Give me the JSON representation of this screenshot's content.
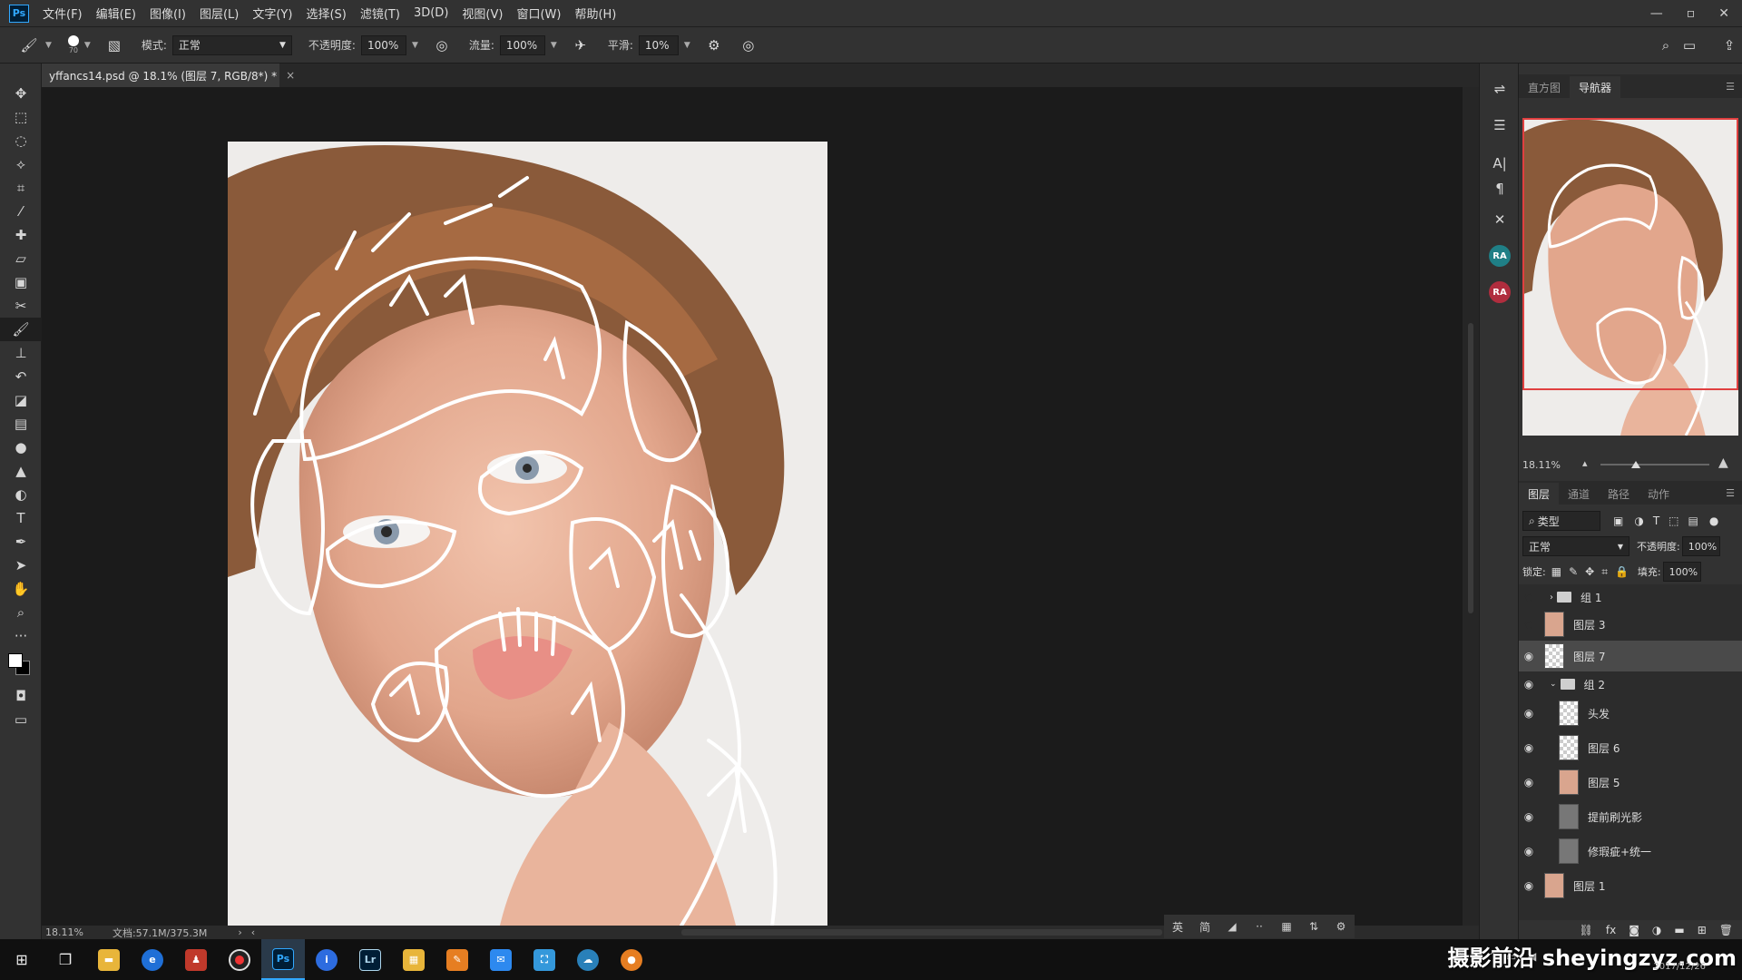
{
  "menubar": {
    "logo": "Ps",
    "items": [
      "文件(F)",
      "编辑(E)",
      "图像(I)",
      "图层(L)",
      "文字(Y)",
      "选择(S)",
      "滤镜(T)",
      "3D(D)",
      "视图(V)",
      "窗口(W)",
      "帮助(H)"
    ],
    "window_controls": [
      "—",
      "▫",
      "✕"
    ]
  },
  "options": {
    "brush_size": "70",
    "mode_label": "模式:",
    "mode_value": "正常",
    "opacity_label": "不透明度:",
    "opacity_value": "100%",
    "flow_label": "流量:",
    "flow_value": "100%",
    "smoothing_label": "平滑:",
    "smoothing_value": "10%"
  },
  "document": {
    "tab_title": "yffancs14.psd @ 18.1% (图层 7, RGB/8*) *",
    "tab_close": "×"
  },
  "status": {
    "zoom": "18.11%",
    "doc_size": "文档:57.1M/375.3M"
  },
  "navigator": {
    "tabs": [
      "直方图",
      "导航器"
    ],
    "active_tab": "导航器",
    "zoom_value": "18.11%"
  },
  "layers_panel": {
    "tabs": [
      "图层",
      "通道",
      "路径",
      "动作"
    ],
    "filter_label": "类型",
    "blend_mode": "正常",
    "opacity_label": "不透明度:",
    "opacity_value": "100%",
    "lock_label": "锁定:",
    "fill_label": "填充:",
    "fill_value": "100%",
    "layers": [
      {
        "name": "组 1",
        "visible": false,
        "kind": "group",
        "indent": 0
      },
      {
        "name": "图层 3",
        "visible": false,
        "kind": "face",
        "indent": 0
      },
      {
        "name": "图层 7",
        "visible": true,
        "kind": "checker",
        "indent": 0,
        "selected": true
      },
      {
        "name": "组 2",
        "visible": true,
        "kind": "group-open",
        "indent": 0
      },
      {
        "name": "头发",
        "visible": true,
        "kind": "checker",
        "indent": 1
      },
      {
        "name": "图层 6",
        "visible": true,
        "kind": "checker",
        "indent": 1
      },
      {
        "name": "图层 5",
        "visible": true,
        "kind": "face",
        "indent": 1
      },
      {
        "name": "提前刷光影",
        "visible": true,
        "kind": "gray",
        "indent": 1
      },
      {
        "name": "修瑕疵+统一",
        "visible": true,
        "kind": "gray",
        "indent": 1
      },
      {
        "name": "图层 1",
        "visible": true,
        "kind": "face",
        "indent": 0
      }
    ]
  },
  "canvas_tools": [
    "英",
    "简",
    "◢",
    "··",
    "▦",
    "⇅",
    "⚙"
  ],
  "taskbar": {
    "watermark": "摄影前沿 sheyingzyz.com",
    "clock": "2017/12/26"
  },
  "colors": {
    "accent": "#31a8ff",
    "nav_box": "#e04040"
  }
}
